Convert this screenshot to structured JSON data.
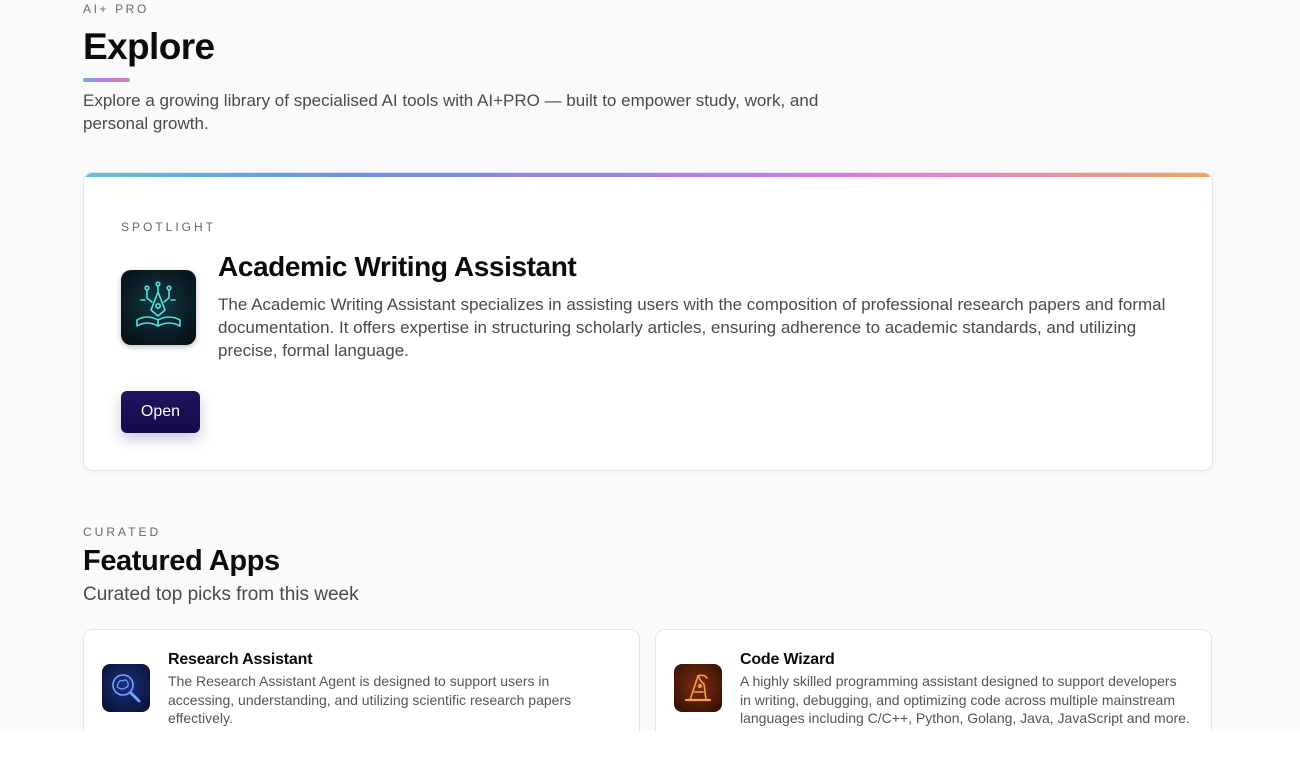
{
  "hero": {
    "eyebrow": "AI+ PRO",
    "title": "Explore",
    "description": "Explore a growing library of specialised AI tools with AI+PRO — built to empower study, work, and personal growth."
  },
  "spotlight": {
    "eyebrow": "SPOTLIGHT",
    "icon": "book-pen-circuit-icon",
    "title": "Academic Writing Assistant",
    "description": "The Academic Writing Assistant specializes in assisting users with the composition of professional research papers and formal documentation. It offers expertise in structuring scholarly articles, ensuring adherence to academic standards, and utilizing precise, formal language.",
    "button_label": "Open",
    "button_color": "#1b0f54"
  },
  "featured": {
    "eyebrow": "CURATED",
    "title": "Featured Apps",
    "subtitle": "Curated top picks from this week",
    "apps": [
      {
        "name": "Research Assistant",
        "icon": "magnifier-brain-icon",
        "description": "The Research Assistant Agent is designed to support users in accessing, understanding, and utilizing scientific research papers effectively."
      },
      {
        "name": "Code Wizard",
        "icon": "wizard-hat-icon",
        "description": "A highly skilled programming assistant designed to support developers in writing, debugging, and optimizing code across multiple mainstream languages including C/C++, Python, Golang, Java, JavaScript and more."
      }
    ]
  },
  "colors": {
    "background": "#fafafa",
    "spotlight_gradient": [
      "#5fc4d2",
      "#6a8cf0",
      "#a47ff0",
      "#f07ad8",
      "#f5a25a"
    ]
  }
}
